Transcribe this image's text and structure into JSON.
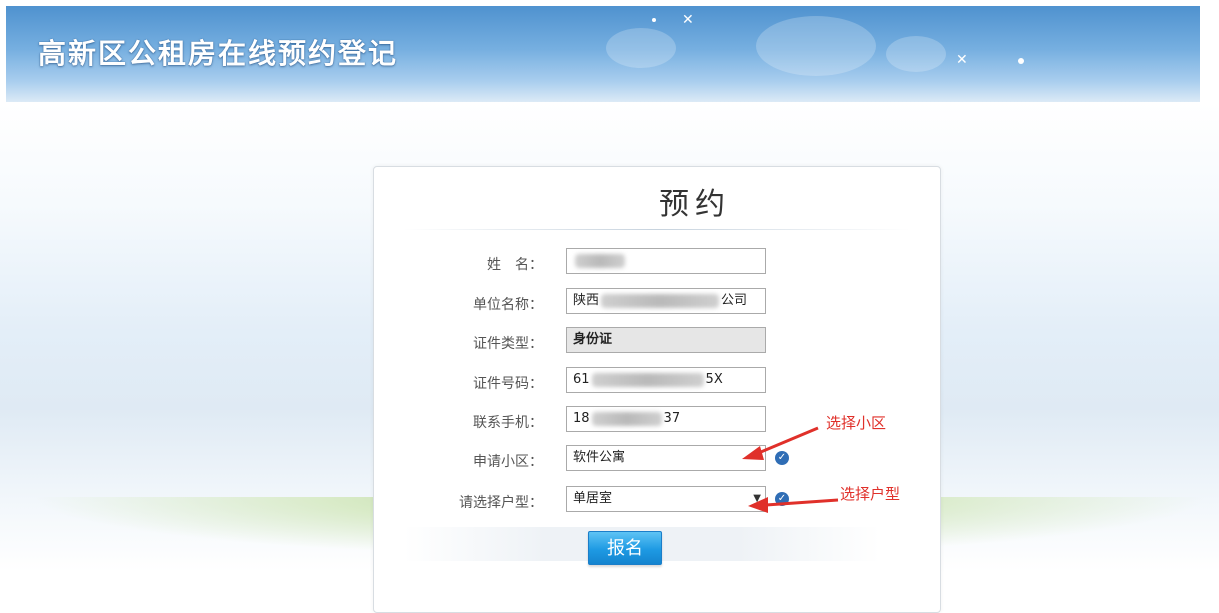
{
  "header": {
    "site_title": "高新区公租房在线预约登记"
  },
  "form": {
    "title": "预约",
    "fields": {
      "name": {
        "label": "姓　名：",
        "value": ""
      },
      "company": {
        "label": "单位名称：",
        "value_prefix": "陕西",
        "value_suffix": "公司"
      },
      "id_type": {
        "label": "证件类型：",
        "value": "身份证"
      },
      "id_number": {
        "label": "证件号码：",
        "value_prefix": "61",
        "value_suffix": "5X"
      },
      "phone": {
        "label": "联系手机：",
        "value_prefix": "18",
        "value_suffix": "37"
      },
      "community": {
        "label": "申请小区：",
        "value": "软件公寓"
      },
      "room_type": {
        "label": "请选择户型：",
        "value": "单居室"
      }
    },
    "submit_label": "报名"
  },
  "annotations": {
    "community": "选择小区",
    "room_type": "选择户型"
  },
  "icons": {
    "check": "check-circle-icon",
    "dropdown": "chevron-down-icon"
  },
  "colors": {
    "header_blue": "#5a9ad4",
    "button_blue": "#1e9ae3",
    "annotation_red": "#e0302a",
    "check_blue": "#2f6db5"
  }
}
